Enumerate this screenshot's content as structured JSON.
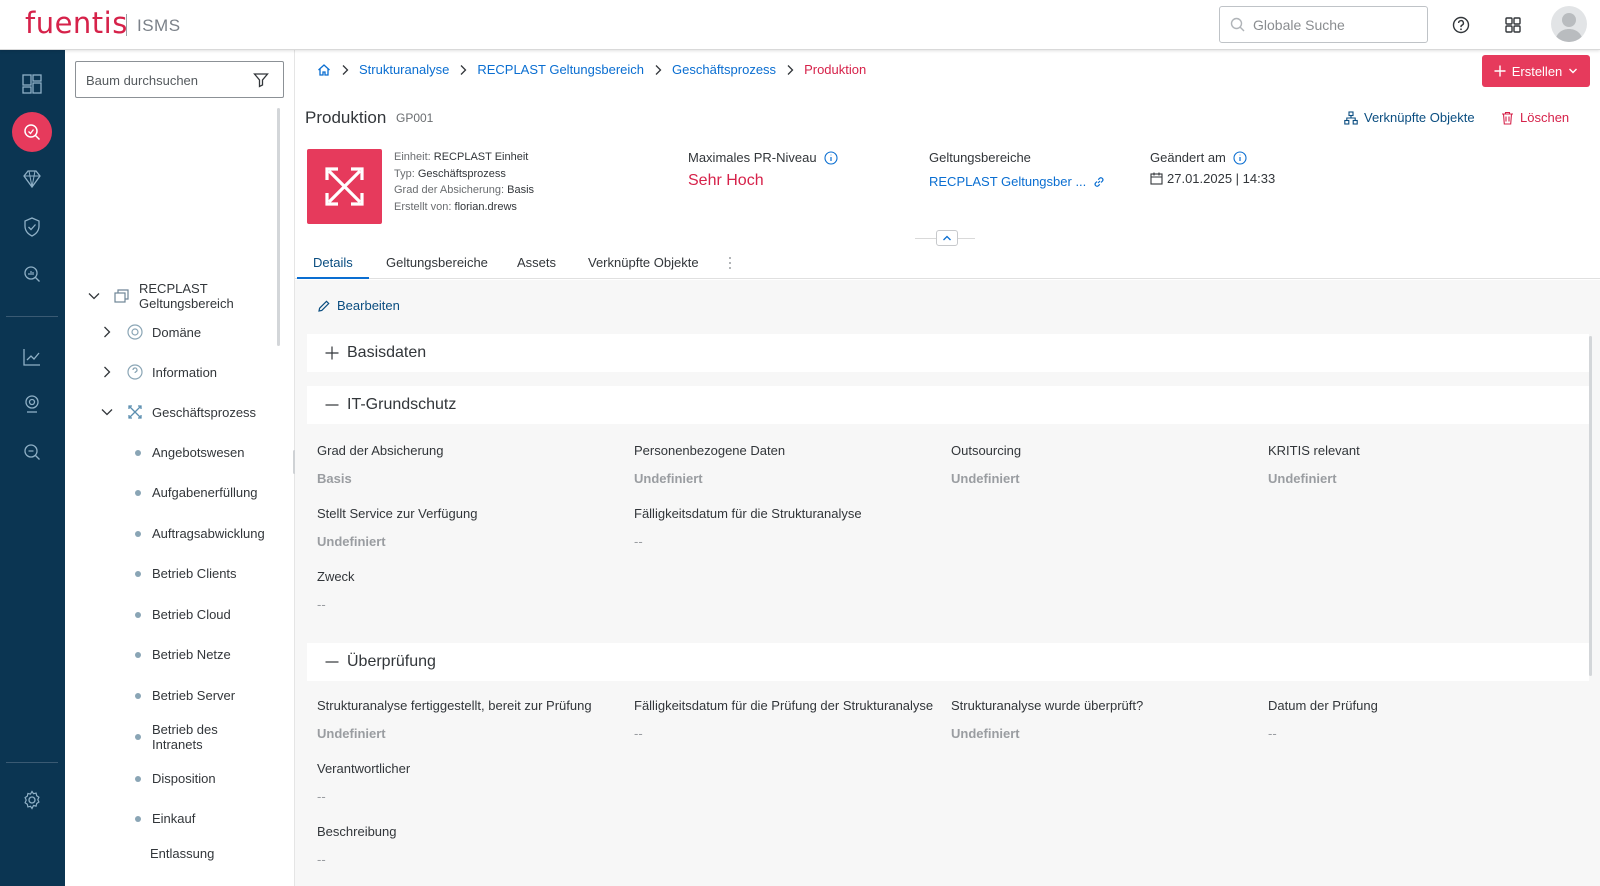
{
  "app": {
    "logo": "fuentis",
    "product": "ISMS"
  },
  "header": {
    "search_placeholder": "Globale Suche"
  },
  "tree": {
    "search_placeholder": "Baum durchsuchen",
    "root": {
      "label_line1": "RECPLAST",
      "label_line2": "Geltungsbereich"
    },
    "groups": [
      {
        "label": "Domäne"
      },
      {
        "label": "Information"
      },
      {
        "label": "Geschäftsprozess"
      }
    ],
    "items": [
      "Angebotswesen",
      "Aufgabenerfüllung",
      "Auftragsabwicklung",
      "Betrieb Clients",
      "Betrieb Cloud",
      "Betrieb Netze",
      "Betrieb Server",
      "Betrieb des",
      "Intranets",
      "Disposition",
      "Einkauf",
      "Entlassung"
    ]
  },
  "breadcrumb": [
    "Strukturanalyse",
    "RECPLAST Geltungsbereich",
    "Geschäftsprozess",
    "Produktion"
  ],
  "toolbar": {
    "create_label": "Erstellen"
  },
  "object": {
    "title": "Produktion",
    "code": "GP001",
    "linked_objects_label": "Verknüpfte Objekte",
    "delete_label": "Löschen",
    "meta": {
      "unit_label": "Einheit:",
      "unit_value": "RECPLAST Einheit",
      "type_label": "Typ:",
      "type_value": "Geschäftsprozess",
      "grade_label": "Grad der Absicherung:",
      "grade_value": "Basis",
      "creator_label": "Erstellt von:",
      "creator_value": "florian.drews"
    },
    "kpis": {
      "pr_label": "Maximales PR-Niveau",
      "pr_value": "Sehr Hoch",
      "scope_label": "Geltungsbereiche",
      "scope_value": "RECPLAST Geltungsber ...",
      "changed_label": "Geändert am",
      "changed_value": "27.01.2025 | 14:33"
    }
  },
  "tabs": [
    "Details",
    "Geltungsbereiche",
    "Assets",
    "Verknüpfte Objekte"
  ],
  "details": {
    "edit_label": "Bearbeiten",
    "sections": {
      "basis": "Basisdaten",
      "itg": "IT-Grundschutz",
      "review": "Überprüfung"
    },
    "itg_fields": [
      {
        "label": "Grad der Absicherung",
        "value": "Basis"
      },
      {
        "label": "Personenbezogene Daten",
        "value": "Undefiniert"
      },
      {
        "label": "Outsourcing",
        "value": "Undefiniert"
      },
      {
        "label": "KRITIS relevant",
        "value": "Undefiniert"
      },
      {
        "label": "Stellt Service zur Verfügung",
        "value": "Undefiniert"
      },
      {
        "label": "Fälligkeitsdatum für die Strukturanalyse",
        "value": "--"
      },
      {
        "label": "Zweck",
        "value": "--"
      }
    ],
    "review_fields": [
      {
        "label": "Strukturanalyse fertiggestellt, bereit zur Prüfung",
        "value": "Undefiniert"
      },
      {
        "label": "Fälligkeitsdatum für die Prüfung der Strukturanalyse",
        "value": "--"
      },
      {
        "label": "Strukturanalyse wurde überprüft?",
        "value": "Undefiniert"
      },
      {
        "label": "Datum der Prüfung",
        "value": "--"
      },
      {
        "label": "Verantwortlicher",
        "value": "--"
      },
      {
        "label": "Beschreibung",
        "value": "--"
      }
    ]
  },
  "colors": {
    "brand": "#d6224a",
    "accent": "#e63a5c",
    "rail": "#0b3552",
    "link": "#0a6ed1"
  }
}
